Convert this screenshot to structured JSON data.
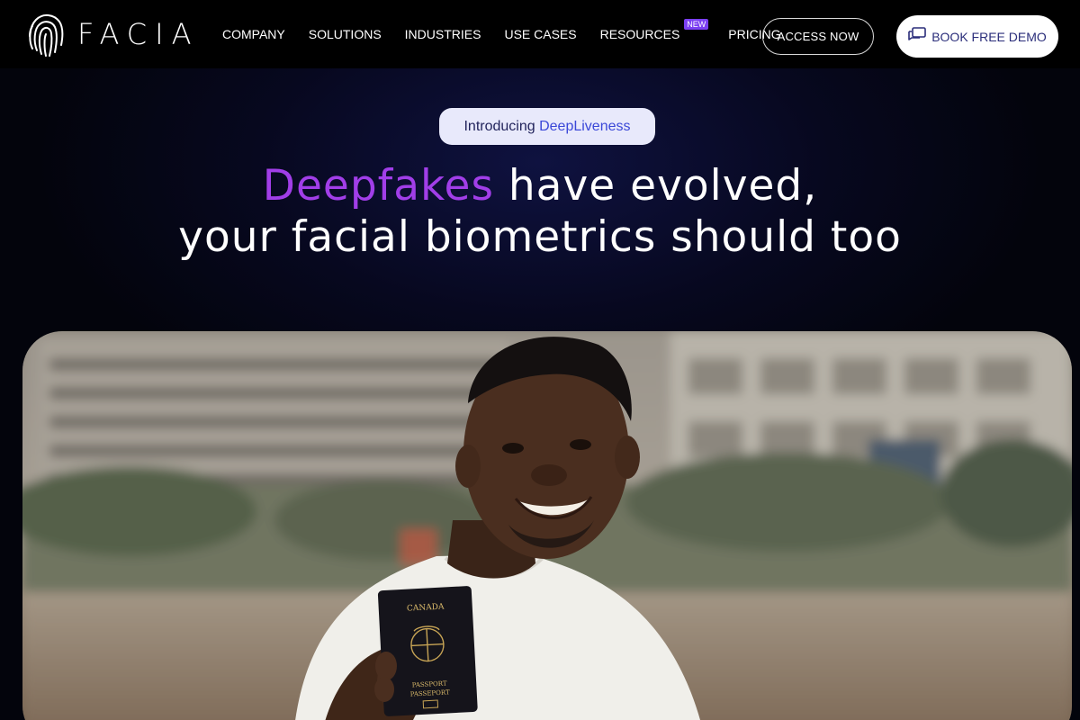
{
  "brand": {
    "name": "FACIA",
    "logo_icon": "fingerprint-icon"
  },
  "nav": {
    "items": [
      {
        "label": "COMPANY"
      },
      {
        "label": "SOLUTIONS"
      },
      {
        "label": "INDUSTRIES"
      },
      {
        "label": "USE CASES"
      },
      {
        "label": "RESOURCES",
        "badge": "NEW"
      },
      {
        "label": "PRICING"
      }
    ],
    "access_label": "ACCESS NOW",
    "demo_label": "BOOK FREE DEMO",
    "demo_icon": "chat-bubbles-icon"
  },
  "hero": {
    "pill_prefix": "Introducing ",
    "pill_accent": "DeepLiveness",
    "headline_highlight": "Deepfakes",
    "headline_rest": " have evolved,",
    "headline_line2": "your facial biometrics should too",
    "passport_country": "CANADA",
    "passport_label1": "PASSPORT",
    "passport_label2": "PASSEPORT"
  },
  "colors": {
    "accent_purple": "#a13ee8",
    "accent_blue": "#3b48d8",
    "badge": "#7b3ff2",
    "nav_bg": "#000000"
  }
}
